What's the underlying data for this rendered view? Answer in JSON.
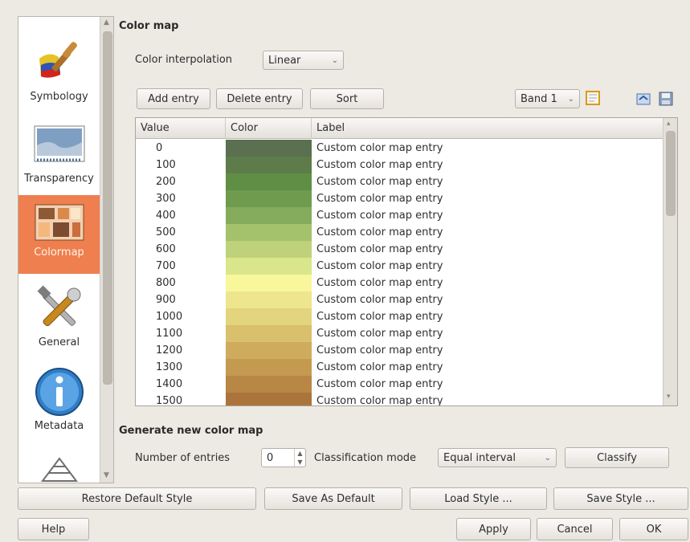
{
  "sidebar": {
    "items": [
      {
        "label": "Symbology",
        "icon": "paintbrush-icon",
        "active": false
      },
      {
        "label": "Transparency",
        "icon": "transparency-icon",
        "active": false
      },
      {
        "label": "Colormap",
        "icon": "colormap-icon",
        "active": true
      },
      {
        "label": "General",
        "icon": "tools-icon",
        "active": false
      },
      {
        "label": "Metadata",
        "icon": "info-icon",
        "active": false
      },
      {
        "label": "",
        "icon": "pyramids-icon",
        "active": false
      }
    ]
  },
  "colormap": {
    "title": "Color map",
    "interpolation_label": "Color interpolation",
    "interpolation_value": "Linear",
    "add_entry": "Add entry",
    "delete_entry": "Delete entry",
    "sort": "Sort",
    "band_value": "Band 1",
    "columns": [
      "Value",
      "Color",
      "Label"
    ],
    "rows": [
      {
        "value": "0",
        "color": "#5b6f51",
        "label": "Custom color map entry"
      },
      {
        "value": "100",
        "color": "#5d7c4a",
        "label": "Custom color map entry"
      },
      {
        "value": "200",
        "color": "#5f8e45",
        "label": "Custom color map entry"
      },
      {
        "value": "300",
        "color": "#6e9b4d",
        "label": "Custom color map entry"
      },
      {
        "value": "400",
        "color": "#85ac5c",
        "label": "Custom color map entry"
      },
      {
        "value": "500",
        "color": "#a3c26b",
        "label": "Custom color map entry"
      },
      {
        "value": "600",
        "color": "#bfd27b",
        "label": "Custom color map entry"
      },
      {
        "value": "700",
        "color": "#d9e68c",
        "label": "Custom color map entry"
      },
      {
        "value": "800",
        "color": "#f8f79c",
        "label": "Custom color map entry"
      },
      {
        "value": "900",
        "color": "#eee58f",
        "label": "Custom color map entry"
      },
      {
        "value": "1000",
        "color": "#e3d47e",
        "label": "Custom color map entry"
      },
      {
        "value": "1100",
        "color": "#d9c06c",
        "label": "Custom color map entry"
      },
      {
        "value": "1200",
        "color": "#cfac5d",
        "label": "Custom color map entry"
      },
      {
        "value": "1300",
        "color": "#c39a50",
        "label": "Custom color map entry"
      },
      {
        "value": "1400",
        "color": "#b88746",
        "label": "Custom color map entry"
      },
      {
        "value": "1500",
        "color": "#ab743c",
        "label": "Custom color map entry"
      }
    ]
  },
  "generate": {
    "title": "Generate new color map",
    "entries_label": "Number of entries",
    "entries_value": "0",
    "mode_label": "Classification mode",
    "mode_value": "Equal interval",
    "classify": "Classify"
  },
  "style_buttons": {
    "restore": "Restore Default Style",
    "save_default": "Save As Default",
    "load": "Load Style ...",
    "save": "Save Style ..."
  },
  "dialog_buttons": {
    "help": "Help",
    "apply": "Apply",
    "cancel": "Cancel",
    "ok": "OK"
  },
  "colors": {
    "accent": "#ef7f4e",
    "window_bg": "#ede9e3"
  }
}
